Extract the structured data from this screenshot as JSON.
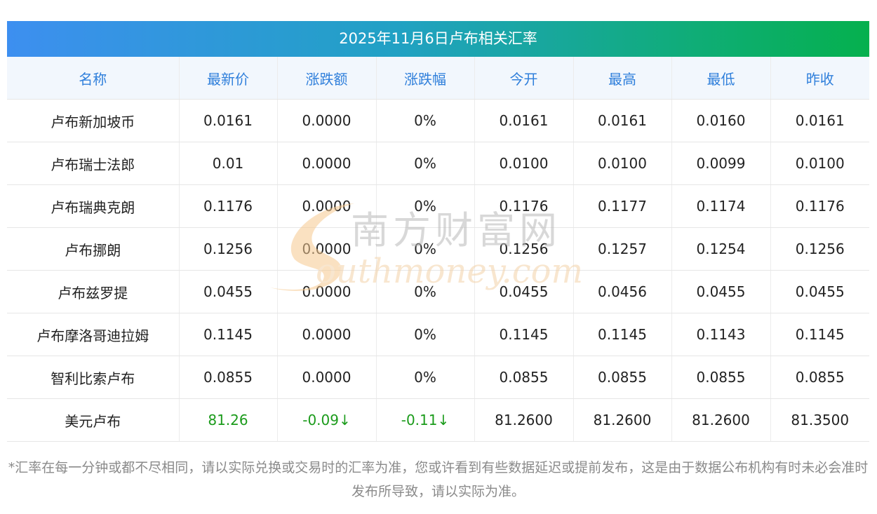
{
  "title": "2025年11月6日卢布相关汇率",
  "columns": [
    "名称",
    "最新价",
    "涨跌额",
    "涨跌幅",
    "今开",
    "最高",
    "最低",
    "昨收"
  ],
  "rows": [
    {
      "name": "卢布新加坡币",
      "latest": "0.0161",
      "change": "0.0000",
      "pct": "0%",
      "open": "0.0161",
      "high": "0.0161",
      "low": "0.0160",
      "prev": "0.0161"
    },
    {
      "name": "卢布瑞士法郎",
      "latest": "0.01",
      "change": "0.0000",
      "pct": "0%",
      "open": "0.0100",
      "high": "0.0100",
      "low": "0.0099",
      "prev": "0.0100"
    },
    {
      "name": "卢布瑞典克朗",
      "latest": "0.1176",
      "change": "0.0000",
      "pct": "0%",
      "open": "0.1176",
      "high": "0.1177",
      "low": "0.1174",
      "prev": "0.1176"
    },
    {
      "name": "卢布挪朗",
      "latest": "0.1256",
      "change": "0.0000",
      "pct": "0%",
      "open": "0.1256",
      "high": "0.1257",
      "low": "0.1254",
      "prev": "0.1256"
    },
    {
      "name": "卢布兹罗提",
      "latest": "0.0455",
      "change": "0.0000",
      "pct": "0%",
      "open": "0.0455",
      "high": "0.0456",
      "low": "0.0455",
      "prev": "0.0455"
    },
    {
      "name": "卢布摩洛哥迪拉姆",
      "latest": "0.1145",
      "change": "0.0000",
      "pct": "0%",
      "open": "0.1145",
      "high": "0.1145",
      "low": "0.1143",
      "prev": "0.1145"
    },
    {
      "name": "智利比索卢布",
      "latest": "0.0855",
      "change": "0.0000",
      "pct": "0%",
      "open": "0.0855",
      "high": "0.0855",
      "low": "0.0855",
      "prev": "0.0855"
    },
    {
      "name": "美元卢布",
      "latest": "81.26",
      "change": "-0.09↓",
      "pct": "-0.11↓",
      "open": "81.2600",
      "high": "81.2600",
      "low": "81.2600",
      "prev": "81.3500"
    }
  ],
  "watermark": {
    "cn": "南方财富网",
    "en": "outhmoney.com"
  },
  "note": "*汇率在每一分钟或都不尽相同，请以实际兑换或交易时的汇率为准，您或许看到有些数据延迟或提前发布，这是由于数据公布机构有时未必会准时发布所导致，请以实际为准。",
  "colors": {
    "header_text": "#2f7fdb",
    "down": "#1b9b1b",
    "title_start": "#3d8ff0",
    "title_end": "#05b04e"
  }
}
